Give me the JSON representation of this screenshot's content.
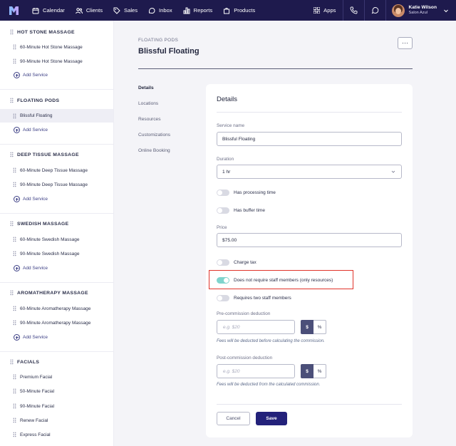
{
  "topnav": {
    "items": [
      {
        "label": "Calendar",
        "icon": "calendar-icon"
      },
      {
        "label": "Clients",
        "icon": "clients-icon"
      },
      {
        "label": "Sales",
        "icon": "tag-icon"
      },
      {
        "label": "Inbox",
        "icon": "inbox-icon"
      },
      {
        "label": "Reports",
        "icon": "reports-icon"
      },
      {
        "label": "Products",
        "icon": "products-icon"
      }
    ],
    "apps_label": "Apps",
    "user": {
      "name": "Katie Wilson",
      "salon": "Salon Azul"
    }
  },
  "sidebar": {
    "categories": [
      {
        "name": "HOT STONE MASSAGE",
        "services": [
          "60-Minute Hot Stone Massage",
          "90-Minute Hot Stone Massage"
        ],
        "add_label": "Add Service"
      },
      {
        "name": "FLOATING PODS",
        "services": [
          "Blissful Floating"
        ],
        "add_label": "Add Service"
      },
      {
        "name": "DEEP TISSUE MASSAGE",
        "services": [
          "60-Minute Deep Tissue Massage",
          "90-Minute Deep Tissue Massage"
        ],
        "add_label": "Add Service"
      },
      {
        "name": "SWEDISH MASSAGE",
        "services": [
          "60-Minute Swedish Massage",
          "90-Minute Swedish Massage"
        ],
        "add_label": "Add Service"
      },
      {
        "name": "AROMATHERAPY MASSAGE",
        "services": [
          "60-Minute Aromatherapy Massage",
          "90-Minute Aromatherapy Massage"
        ],
        "add_label": "Add Service"
      },
      {
        "name": "FACIALS",
        "services": [
          "Premium Facial",
          "50-Minute Facial",
          "90-Minute Facial",
          "Renew Facial",
          "Express Facial"
        ]
      }
    ],
    "active_service": "Blissful Floating"
  },
  "header": {
    "breadcrumb": "FLOATING PODS",
    "title": "Blissful Floating",
    "more_label": "···"
  },
  "subnav": [
    "Details",
    "Locations",
    "Resources",
    "Customizations",
    "Online Booking"
  ],
  "form": {
    "title": "Details",
    "service_name_label": "Service name",
    "service_name_value": "Blissful Floating",
    "duration_label": "Duration",
    "duration_value": "1 hr",
    "has_processing_time": {
      "label": "Has processing time",
      "on": false
    },
    "has_buffer_time": {
      "label": "Has buffer time",
      "on": false
    },
    "price_label": "Price",
    "price_value": "$75.00",
    "charge_tax": {
      "label": "Charge tax",
      "on": false
    },
    "no_staff_required": {
      "label": "Does not require staff members (only resources)",
      "on": true
    },
    "requires_two_staff": {
      "label": "Requires two staff members",
      "on": false
    },
    "pre_commission": {
      "label": "Pre-commission deduction",
      "placeholder": "e.g. $20",
      "unit_dollar": "$",
      "unit_percent": "%",
      "hint": "Fees will be deducted before calculating the commission."
    },
    "post_commission": {
      "label": "Post-commission deduction",
      "placeholder": "e.g. $20",
      "unit_dollar": "$",
      "unit_percent": "%",
      "hint": "Fees will be deducted from the calculated commission."
    },
    "cancel_label": "Cancel",
    "save_label": "Save"
  },
  "colors": {
    "nav_bg": "#1e1a4d",
    "primary": "#23217a",
    "toggle_on": "#7fd4cd",
    "highlight": "#e0332a"
  }
}
